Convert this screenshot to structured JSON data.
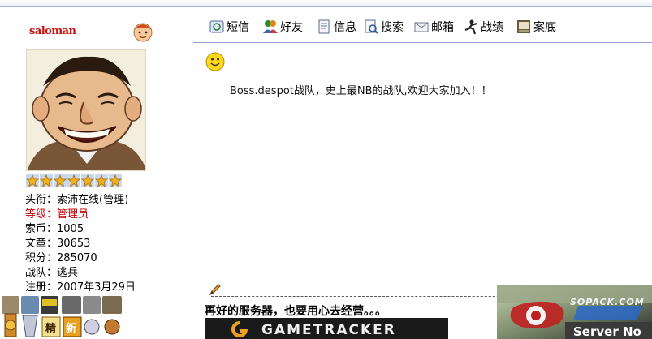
{
  "profile": {
    "username": "saloman",
    "title_label": "头衔：",
    "title_value": "索沛在线(管理)",
    "rank_label": "等级：",
    "rank_value": "管理员",
    "coins_label": "索币：",
    "coins_value": "1005",
    "posts_label": "文章：",
    "posts_value": "30653",
    "points_label": "积分：",
    "points_value": "285070",
    "team_label": "战队：",
    "team_value": "逃兵",
    "registered_label": "注册：",
    "registered_value": "2007年3月29日",
    "star_count": 7,
    "accent_red": "#c00000"
  },
  "toolbar": {
    "items": [
      {
        "label": "短信",
        "icon": "message-icon"
      },
      {
        "label": "好友",
        "icon": "friends-icon"
      },
      {
        "label": "信息",
        "icon": "info-icon"
      },
      {
        "label": "搜索",
        "icon": "search-icon"
      },
      {
        "label": "邮箱",
        "icon": "mail-icon"
      },
      {
        "label": "战绩",
        "icon": "record-icon"
      },
      {
        "label": "案底",
        "icon": "file-icon"
      }
    ]
  },
  "post": {
    "message": "Boss.despot战队，史上最NB的战队,欢迎大家加入！！",
    "signature": "再好的服务器，也要用心去经营。。。",
    "banner_text": "GAMETRACKER",
    "server_text": "Server No",
    "site_name": "SOPACK.COM"
  }
}
